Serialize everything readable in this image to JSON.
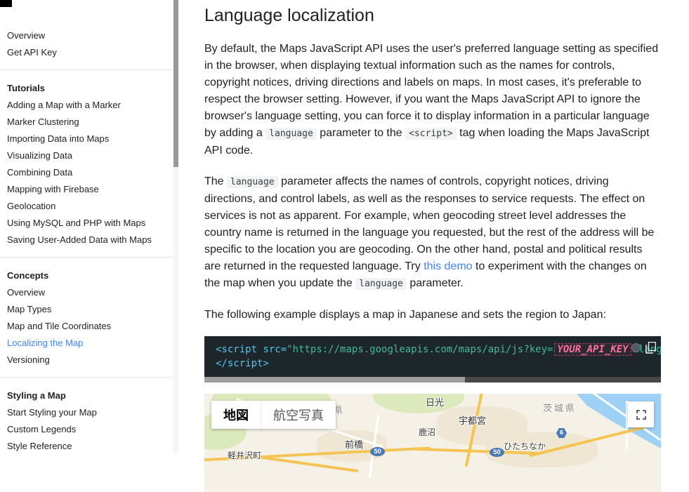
{
  "colors": {
    "accent_blue": "#4285f4",
    "sidebar_active": "#4285f4",
    "inline_code_bg": "#f1f3f4",
    "code_block_bg": "#1d272b",
    "code_tag": "#53c7ec",
    "code_string": "#45b89c",
    "code_placeholder_pink": "#ff6e9c",
    "map_water": "#9fd1f7",
    "map_land": "#f5f1e6",
    "map_road_orange": "#f4c554",
    "route_shield_blue": "#4a79b5"
  },
  "sidebar": {
    "sections": [
      {
        "items": [
          "Overview",
          "Get API Key"
        ]
      },
      {
        "heading": "Tutorials",
        "items": [
          "Adding a Map with a Marker",
          "Marker Clustering",
          "Importing Data into Maps",
          "Visualizing Data",
          "Combining Data",
          "Mapping with Firebase",
          "Geolocation",
          "Using MySQL and PHP with Maps",
          "Saving User-Added Data with Maps"
        ]
      },
      {
        "heading": "Concepts",
        "items": [
          "Overview",
          "Map Types",
          "Map and Tile Coordinates",
          "Localizing the Map",
          "Versioning"
        ],
        "active_item": "Localizing the Map"
      },
      {
        "heading": "Styling a Map",
        "items": [
          "Start Styling your Map",
          "Custom Legends",
          "Style Reference"
        ]
      }
    ]
  },
  "main": {
    "title": "Language localization",
    "p1": [
      {
        "t": "By default, the Maps JavaScript API uses the user's preferred language setting as specified in the browser, when displaying textual information such as the names for controls, copyright notices, driving directions and labels on maps. In most cases, it's preferable to respect the browser setting. However, if you want the Maps JavaScript API to ignore the browser's language setting, you can force it to display information in a particular language by adding a "
      },
      {
        "k": "code",
        "t": "language"
      },
      {
        "t": " parameter to the "
      },
      {
        "k": "code",
        "t": "<script>"
      },
      {
        "t": " tag when loading the Maps JavaScript API code."
      }
    ],
    "p2": [
      {
        "t": "The "
      },
      {
        "k": "code",
        "t": "language"
      },
      {
        "t": " parameter affects the names of controls, copyright notices, driving directions, and control labels, as well as the responses to service requests. The effect on services is not as apparent. For example, when geocoding street level addresses the country name is returned in the language you requested, but the rest of the address will be specific to the location you are geocoding. On the other hand, postal and political results are returned in the requested language. Try "
      },
      {
        "k": "link",
        "t": "this demo",
        "n": "demo-link"
      },
      {
        "t": " to experiment with the changes on the map when you update the "
      },
      {
        "k": "code",
        "t": "language"
      },
      {
        "t": " parameter."
      }
    ],
    "p3": "The following example displays a map in Japanese and sets the region to Japan:"
  },
  "code": {
    "icons": [
      "theme-toggle-icon",
      "copy-icon"
    ],
    "lines": [
      [
        {
          "k": "tag",
          "t": "<script"
        },
        {
          "k": "plain",
          "t": " "
        },
        {
          "k": "attr",
          "t": "src="
        },
        {
          "k": "str",
          "t": "\"https://maps.googleapis.com/maps/api/js?key="
        },
        {
          "k": "var",
          "t": "YOUR_API_KEY"
        },
        {
          "k": "str",
          "t": "&language"
        }
      ],
      [
        {
          "k": "tag",
          "t": "</script>"
        }
      ]
    ]
  },
  "map": {
    "controls": {
      "map_label": "地図",
      "satellite_label": "航空写真",
      "fullscreen_icon": "fullscreen-icon"
    },
    "labels": [
      {
        "text": "日光",
        "type": "city"
      },
      {
        "text": "県",
        "type": "pref"
      },
      {
        "text": "茨城県",
        "type": "pref"
      },
      {
        "text": "宇都宮",
        "type": "city"
      },
      {
        "text": "鹿沼",
        "type": "small"
      },
      {
        "text": "前橋",
        "type": "city"
      },
      {
        "text": "ひたちなか",
        "type": "small"
      },
      {
        "text": "軽井沢町",
        "type": "small"
      }
    ],
    "shields": [
      {
        "text": "50",
        "shape": "oval"
      },
      {
        "text": "50",
        "shape": "oval"
      },
      {
        "text": "6",
        "shape": "hex"
      }
    ]
  }
}
